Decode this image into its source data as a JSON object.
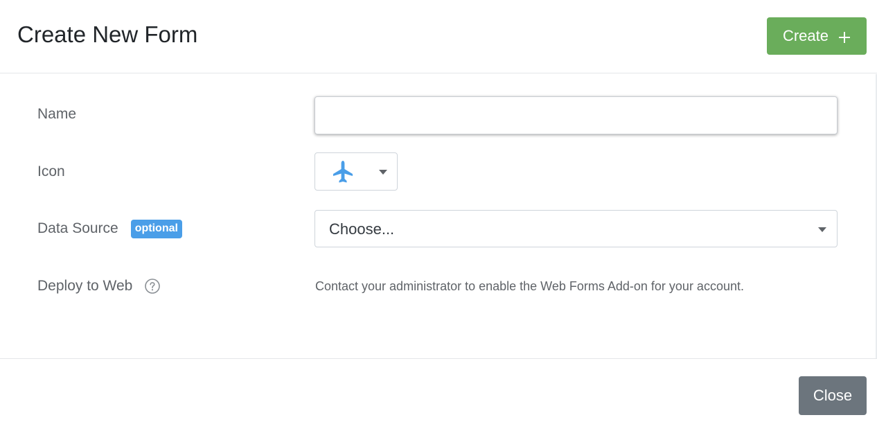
{
  "header": {
    "title": "Create New Form",
    "create_label": "Create",
    "create_icon": "plus-icon",
    "create_color": "#6aad5b"
  },
  "form": {
    "name": {
      "label": "Name",
      "value": "",
      "placeholder": ""
    },
    "icon": {
      "label": "Icon",
      "selected_icon": "airplane-icon",
      "icon_color": "#4a9ee8"
    },
    "data_source": {
      "label": "Data Source",
      "badge": "optional",
      "badge_color": "#4a9ee8",
      "selected": "Choose..."
    },
    "deploy": {
      "label": "Deploy to Web",
      "help_icon": "question-circle-icon",
      "message": "Contact your administrator to enable the Web Forms Add-on for your account."
    }
  },
  "footer": {
    "close_label": "Close",
    "close_color": "#6c757d"
  }
}
